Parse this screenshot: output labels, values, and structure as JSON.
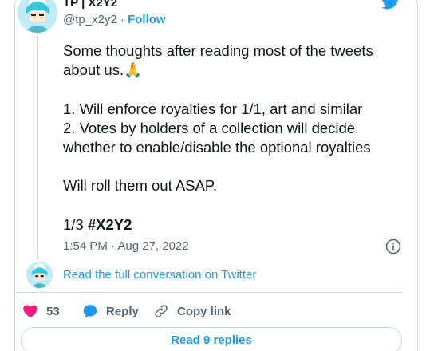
{
  "author": {
    "name": "TP | X2Y2",
    "handle": "@tp_x2y2",
    "separator": " · ",
    "follow_label": "Follow"
  },
  "tweet": {
    "paragraphs": [
      "Some thoughts after reading most of the tweets about us.🙏",
      "",
      "1. Will enforce royalties for 1/1, art and similar",
      "2. Votes by holders of a collection will decide whether to enable/disable the optional royalties",
      "",
      "Will roll them out ASAP.",
      ""
    ],
    "count_prefix": "1/3 ",
    "hashtag": "#X2Y2",
    "timestamp": "1:54 PM · Aug 27, 2022"
  },
  "conversation_link": "Read the full conversation on Twitter",
  "actions": {
    "like_count": "53",
    "reply_label": "Reply",
    "copy_label": "Copy link"
  },
  "read_replies_label": "Read 9 replies",
  "colors": {
    "accent": "#1d9bf0",
    "like": "#f91880",
    "text": "#0f1419",
    "muted": "#536471",
    "border": "#cfd9de"
  },
  "icons": {
    "brand": "twitter-bird-icon",
    "info": "info-icon",
    "like": "heart-icon",
    "reply": "speech-bubble-icon",
    "copy": "link-icon"
  }
}
